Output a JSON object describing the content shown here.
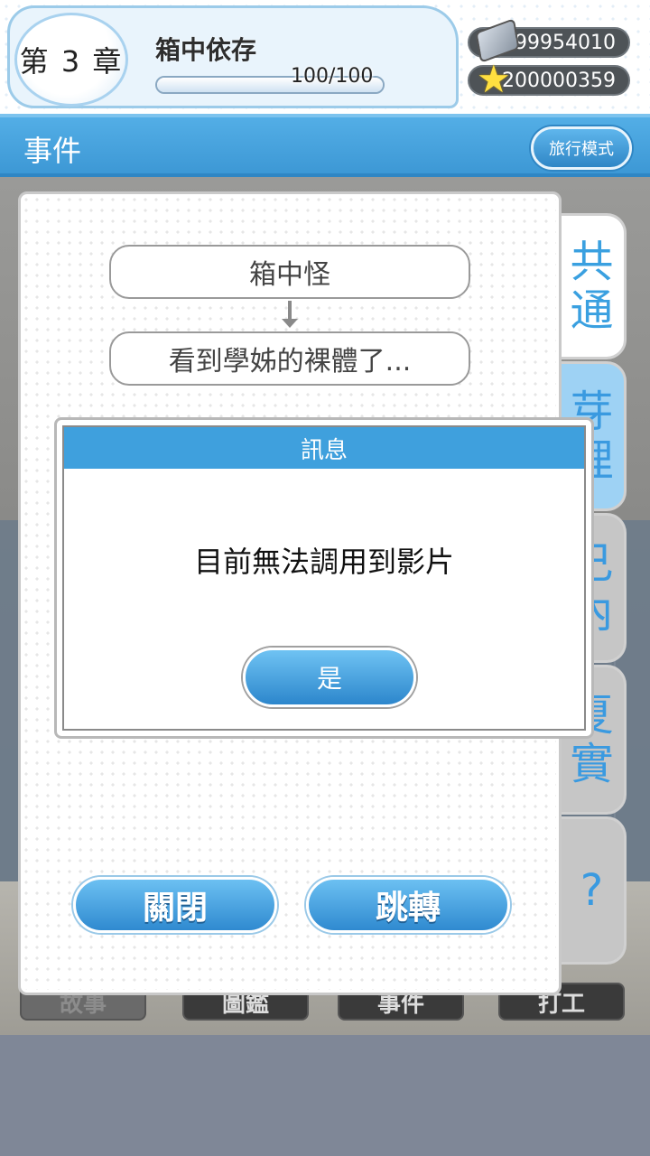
{
  "header": {
    "chapter_label": "第 3 章",
    "stage_title": "箱中依存",
    "progress_text": "100/100",
    "progress_fraction": 1.0,
    "gems": "99954010",
    "stars": "200000359",
    "gem_icon": "gem-icon",
    "star_icon": "star-icon"
  },
  "section": {
    "title": "事件",
    "travel_mode_label": "旅行模式"
  },
  "event_flow": {
    "nodes": [
      "箱中怪",
      "看到學姊的裸體了..."
    ]
  },
  "panel_buttons": {
    "close_label": "關閉",
    "jump_label": "跳轉"
  },
  "side_tabs": [
    {
      "label": "共\n通"
    },
    {
      "label": "芽\n理"
    },
    {
      "label": "己\n內"
    },
    {
      "label": "夏\n實"
    },
    {
      "label": "?"
    }
  ],
  "bottom_nav": [
    {
      "label": "故事"
    },
    {
      "label": "圖鑑"
    },
    {
      "label": "事件"
    },
    {
      "label": "打工"
    }
  ],
  "modal": {
    "title": "訊息",
    "message": "目前無法調用到影片",
    "ok_label": "是"
  },
  "colors": {
    "accent_blue": "#3fa0dd",
    "section_bar": "#3d98d5",
    "tab_text": "#3aa0e0"
  }
}
